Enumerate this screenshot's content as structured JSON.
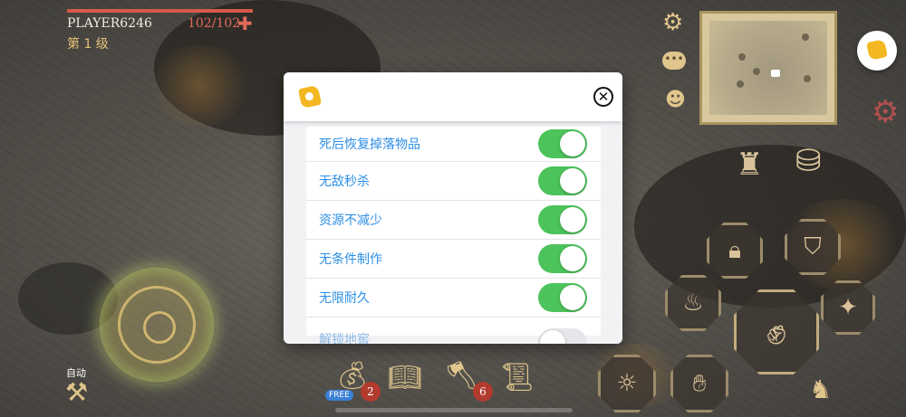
{
  "player": {
    "name": "PLAYER6246",
    "hp_text": "102/102",
    "hp_fraction": 1.0,
    "level": "第 1 级"
  },
  "auto_label": "自动",
  "modal": {
    "rows": [
      {
        "label": "死后恢复掉落物品",
        "enabled": true
      },
      {
        "label": "无敌秒杀",
        "enabled": true
      },
      {
        "label": "资源不减少",
        "enabled": true
      },
      {
        "label": "无条件制作",
        "enabled": true
      },
      {
        "label": "无限耐久",
        "enabled": true
      },
      {
        "label": "解锁地窖",
        "enabled": false
      }
    ]
  },
  "bottom_bar": {
    "free_label": "FREE",
    "badge_1": "2",
    "badge_2": "6"
  },
  "colors": {
    "toggle_on": "#4cc35b",
    "label_blue": "#2d8fe6",
    "gold": "#e0c58c",
    "hp_red": "#d65a4b"
  }
}
